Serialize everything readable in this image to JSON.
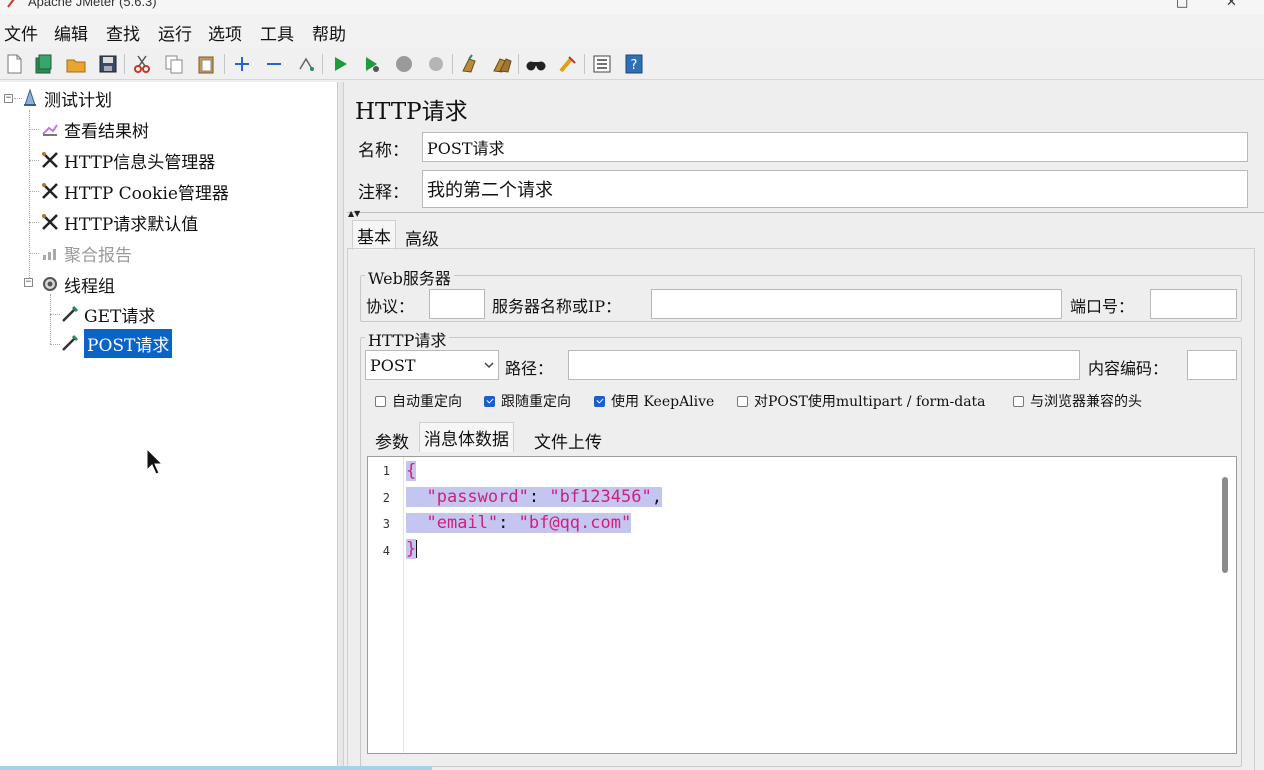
{
  "window": {
    "title": "Apache JMeter (5.6.3)",
    "minimize": "—",
    "maximize": "□",
    "close": "✕"
  },
  "menu": [
    "文件",
    "编辑",
    "查找",
    "运行",
    "选项",
    "工具",
    "帮助"
  ],
  "toolbar": {
    "icons": [
      "new-icon",
      "templates-icon",
      "open-icon",
      "save-icon",
      "cut-icon",
      "copy-icon",
      "paste-icon",
      "expand-icon",
      "collapse-icon",
      "toggle-icon",
      "start-icon",
      "start-no-pause-icon",
      "stop-icon",
      "shutdown-icon",
      "clear-icon",
      "clear-all-icon",
      "search-icon",
      "reset-search-icon",
      "function-helper-icon",
      "help-icon"
    ]
  },
  "tree": {
    "items": [
      {
        "label": "测试计划",
        "icon": "test-plan-icon"
      },
      {
        "label": "查看结果树",
        "icon": "listener-icon"
      },
      {
        "label": "HTTP信息头管理器",
        "icon": "config-icon"
      },
      {
        "label": "HTTP Cookie管理器",
        "icon": "config-icon"
      },
      {
        "label": "HTTP请求默认值",
        "icon": "config-icon"
      },
      {
        "label": "聚合报告",
        "icon": "report-icon",
        "disabled": true
      },
      {
        "label": "线程组",
        "icon": "thread-group-icon"
      },
      {
        "label": "GET请求",
        "icon": "sampler-icon"
      },
      {
        "label": "POST请求",
        "icon": "sampler-icon",
        "selected": true
      }
    ]
  },
  "panel": {
    "title": "HTTP请求",
    "name_label": "名称：",
    "name_value": "POST请求",
    "comment_label": "注释：",
    "comment_value": "我的第二个请求",
    "tabs": [
      "基本",
      "高级"
    ],
    "web_server": {
      "legend": "Web服务器",
      "protocol_label": "协议：",
      "protocol_value": "",
      "server_label": "服务器名称或IP：",
      "server_value": "",
      "port_label": "端口号：",
      "port_value": ""
    },
    "http_request": {
      "legend": "HTTP请求",
      "method": "POST",
      "path_label": "路径：",
      "path_value": "",
      "encoding_label": "内容编码：",
      "encoding_value": ""
    },
    "options": [
      {
        "label": "自动重定向",
        "checked": false
      },
      {
        "label": "跟随重定向",
        "checked": true
      },
      {
        "label": "使用 KeepAlive",
        "checked": true
      },
      {
        "label": "对POST使用multipart / form-data",
        "checked": false
      },
      {
        "label": "与浏览器兼容的头",
        "checked": false
      }
    ],
    "body_tabs": [
      "参数",
      "消息体数据",
      "文件上传"
    ],
    "body": {
      "line_numbers": [
        "1",
        "2",
        "3",
        "4"
      ],
      "open_brace": "{",
      "key1": "\"password\"",
      "colon": ": ",
      "val1": "\"bf123456\"",
      "comma": ",",
      "key2": "\"email\"",
      "val2": "\"bf@qq.com\"",
      "close_brace": "}"
    }
  },
  "colors": {
    "selection": "#0a64c8",
    "string": "#d21f7b",
    "highlight": "#c5c5f2"
  }
}
